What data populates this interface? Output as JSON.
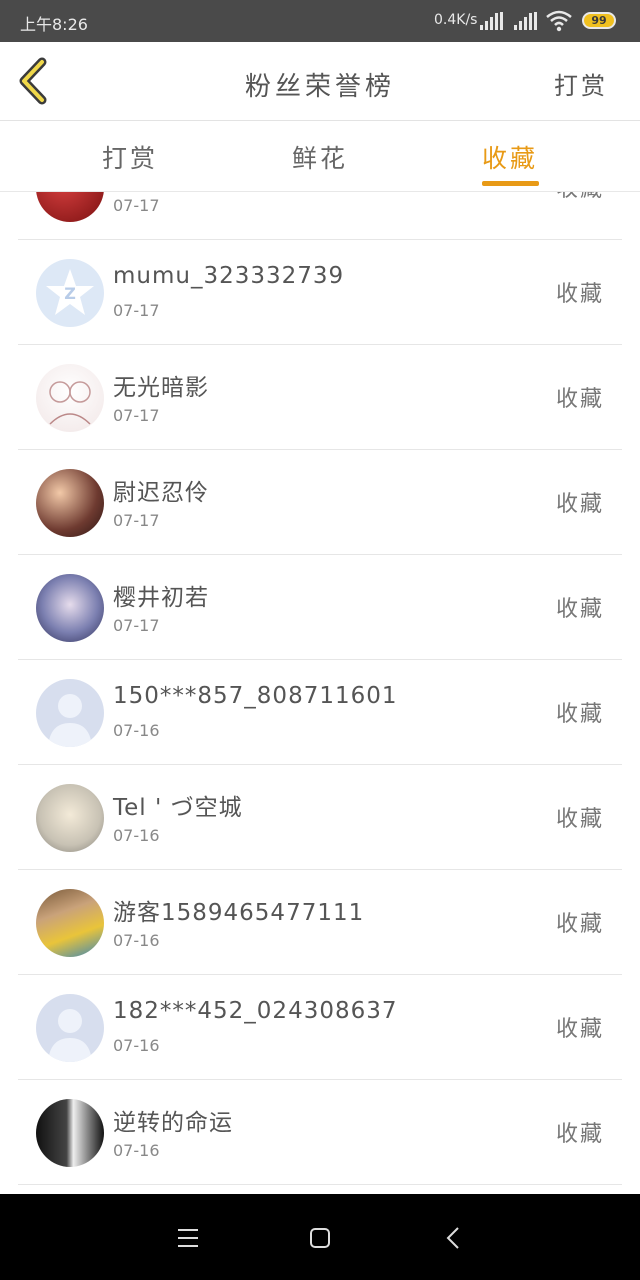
{
  "status_bar": {
    "time": "上午8:26",
    "net_speed": "0.4K/s",
    "battery": "99"
  },
  "header": {
    "title": "粉丝荣誉榜",
    "right_label": "打赏"
  },
  "tabs": [
    {
      "label": "打赏",
      "active": false
    },
    {
      "label": "鲜花",
      "active": false
    },
    {
      "label": "收藏",
      "active": true
    }
  ],
  "list": {
    "partial_row": {
      "date": "07-17",
      "action": "收藏"
    },
    "items": [
      {
        "name": "mumu_323332739",
        "date": "07-17",
        "action": "收藏",
        "avatar": "qq-star-avatar"
      },
      {
        "name": "无光暗影",
        "date": "07-17",
        "action": "收藏",
        "avatar": "sketch-avatar"
      },
      {
        "name": "尉迟忍伶",
        "date": "07-17",
        "action": "收藏",
        "avatar": "anime-avatar"
      },
      {
        "name": "樱井初若",
        "date": "07-17",
        "action": "收藏",
        "avatar": "anime-avatar"
      },
      {
        "name": "150***857_808711601",
        "date": "07-16",
        "action": "收藏",
        "avatar": "default-avatar"
      },
      {
        "name": "Tel ' づ空城",
        "date": "07-16",
        "action": "收藏",
        "avatar": "anime-avatar"
      },
      {
        "name": "游客1589465477111",
        "date": "07-16",
        "action": "收藏",
        "avatar": "photo-avatar"
      },
      {
        "name": "182***452_024308637",
        "date": "07-16",
        "action": "收藏",
        "avatar": "default-avatar"
      },
      {
        "name": "逆转的命运",
        "date": "07-16",
        "action": "收藏",
        "avatar": "dark-avatar"
      }
    ]
  },
  "colors": {
    "accent": "#e89a16",
    "status_bar": "#4a4a4a",
    "nav_bar": "#000000"
  }
}
